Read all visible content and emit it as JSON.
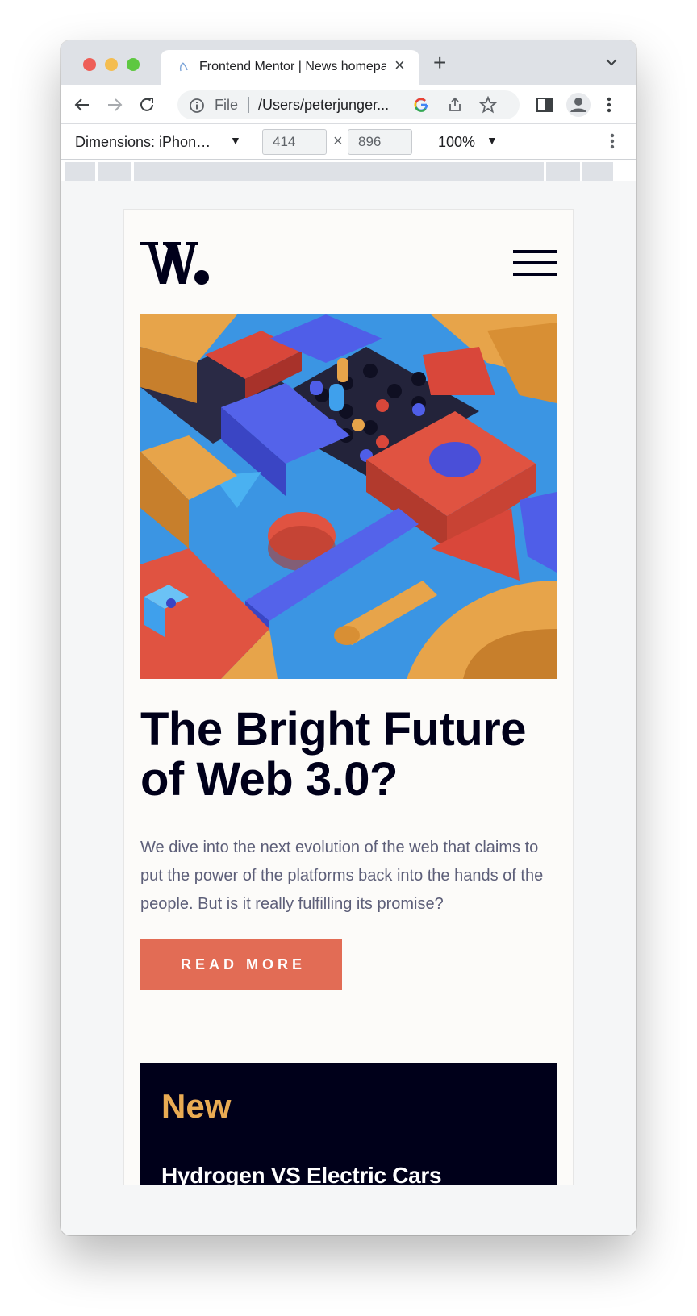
{
  "browser": {
    "tab_title": "Frontend Mentor | News homepage",
    "new_tab_symbol": "+",
    "omnibox_scheme": "File",
    "omnibox_url": "/Users/peterjunger...",
    "device_label": "Dimensions: iPhon…",
    "width_value": "414",
    "height_value": "896",
    "dimension_separator": "×",
    "zoom_value": "100%"
  },
  "page": {
    "logo_alt": "W.",
    "headline": "The Bright Future of Web 3.0?",
    "lead": "We dive into the next evolution of the web that claims to put the power of the platforms back into the hands of the people. But is it really fulfilling its promise?",
    "cta_label": "READ MORE",
    "new_section": {
      "heading": "New",
      "items": [
        "Hydrogen VS Electric Cars"
      ]
    }
  },
  "colors": {
    "accent_red": "#e26c55",
    "accent_orange": "#e9ab53",
    "dark_navy": "#00001a",
    "grayish_blue": "#5d5f79",
    "off_white": "#fcfbf9"
  },
  "icons": [
    "back-arrow-icon",
    "forward-arrow-icon",
    "reload-icon",
    "info-icon",
    "google-icon",
    "share-icon",
    "star-icon",
    "side-panel-icon",
    "profile-icon",
    "kebab-menu-icon",
    "hamburger-menu-icon",
    "chevron-down-icon",
    "tab-favicon"
  ]
}
